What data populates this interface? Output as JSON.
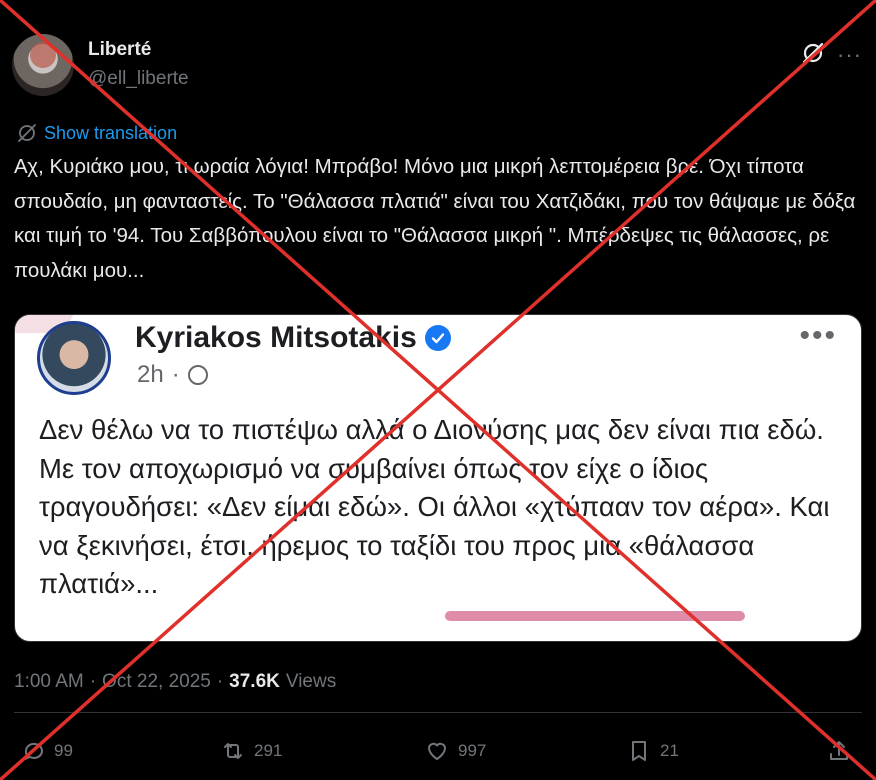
{
  "author": {
    "name": "Liberté",
    "handle": "@ell_liberte"
  },
  "translate_label": "Show translation",
  "post_text": "Αχ, Κυριάκο μου, τι ωραία λόγια! Μπράβο! Μόνο μια μικρή λεπτομέρεια βρε. Όχι τίποτα σπουδαίο, μη φανταστείς. Το \"Θάλασσα πλατιά\" είναι του Χατζιδάκι, που τον θάψαμε με δόξα και τιμή το '94. Του Σαββόπουλου είναι το \"Θάλασσα μικρή \". Μπέρδεψες τις θάλασσες, ρε πουλάκι μου...",
  "embedded": {
    "name": "Kyriakos Mitsotakis",
    "time": "2h",
    "dot": "·",
    "more": "•••",
    "body": "Δεν θέλω να το πιστέψω αλλά ο Διονύσης μας δεν είναι πια εδώ. Με τον αποχωρισμό να συμβαίνει όπως τον είχε ο ίδιος τραγουδήσει: «Δεν είμαι εδώ». Οι άλλοι «χτύπααν τον αέρα». Και να ξεκινήσει, έτσι, ήρεμος το ταξίδι του προς μια «θάλασσα πλατιά»..."
  },
  "meta": {
    "time": "1:00 AM",
    "sep": "·",
    "date": "Oct 22, 2025",
    "views_count": "37.6K",
    "views_label": "Views"
  },
  "actions": {
    "replies": "99",
    "reposts": "291",
    "likes": "997",
    "bookmarks": "21"
  },
  "more_dots": "···",
  "colors": {
    "cross": "#e0302b",
    "link": "#1d9bf0",
    "underline": "#d9789c"
  }
}
